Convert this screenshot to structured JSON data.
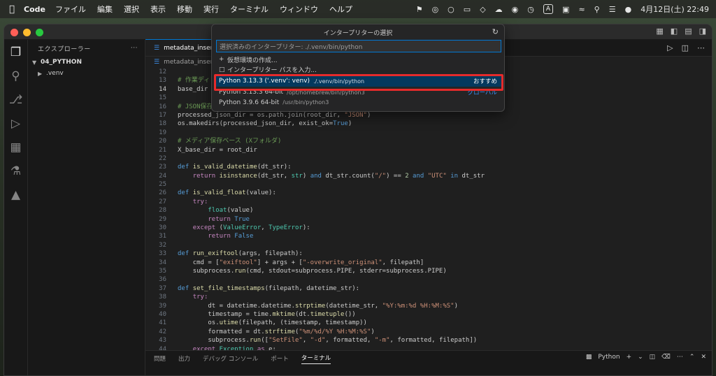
{
  "menubar": {
    "apple": "",
    "app": "Code",
    "items": [
      "ファイル",
      "編集",
      "選択",
      "表示",
      "移動",
      "実行",
      "ターミナル",
      "ウィンドウ",
      "ヘルプ"
    ],
    "ime": "A",
    "clock": "4月12日(土)  22:49"
  },
  "sidebar": {
    "header": "エクスプローラー",
    "more": "···",
    "folder": "04_PYTHON",
    "subfolder": ".venv"
  },
  "editor": {
    "tab_label": "metadata_insert.py",
    "breadcrumb": "metadata_insert.py"
  },
  "quickpick": {
    "title": "インタープリターの選択",
    "input_value": "選択済みのインタープリター: ./.venv/bin/python",
    "create_env": "仮想環境の作成...",
    "enter_path": "インタープリター パスを入力...",
    "options": [
      {
        "name": "Python 3.13.3 ('.venv': venv)",
        "path": "./.venv/bin/python",
        "tag": "おすすめ"
      },
      {
        "name": "Python 3.13.3 64-bit",
        "path": "/opt/homebrew/bin/python3",
        "tag": "グローバル"
      },
      {
        "name": "Python 3.9.6 64-bit",
        "path": "/usr/bin/python3",
        "tag": ""
      }
    ]
  },
  "code": {
    "line_numbers": [
      "12",
      "13",
      "14",
      "15",
      "16",
      "17",
      "18",
      "19",
      "20",
      "21",
      "22",
      "23",
      "24",
      "25",
      "26",
      "27",
      "28",
      "29",
      "30",
      "31",
      "32",
      "33",
      "34",
      "35",
      "36",
      "37",
      "38",
      "39",
      "40",
      "41",
      "42",
      "43",
      "44"
    ],
    "l12": "",
    "l13": "# 作業ディレ",
    "l14a": "base_dir = ",
    "l16": "# JSON保存先",
    "l17a": "processed_json_dir = os.path.join(root_dir, ",
    "l17s": "\"JSON\"",
    "l17b": ")",
    "l18a": "os.makedirs(processed_json_dir, exist_ok=",
    "l18k": "True",
    "l18b": ")",
    "l20": "# メディア保存ベース (Xフォルダ)",
    "l21": "X_base_dir = root_dir",
    "l23k": "def ",
    "l23f": "is_valid_datetime",
    "l23b": "(dt_str):",
    "l24k": "return ",
    "l24f": "isinstance",
    "l24a": "(dt_str, ",
    "l24t": "str",
    "l24b": ") ",
    "l24and": "and",
    "l24c": " dt_str.count(",
    "l24s1": "\"/\"",
    "l24d": ") == ",
    "l24n": "2",
    "l24e": " ",
    "l24and2": "and",
    "l24f2": " ",
    "l24s2": "\"UTC\"",
    "l24g": " ",
    "l24in": "in",
    "l24h": " dt_str",
    "l26k": "def ",
    "l26f": "is_valid_float",
    "l26b": "(value):",
    "l27": "try:",
    "l28f": "float",
    "l28b": "(value)",
    "l29k": "return ",
    "l29v": "True",
    "l30k": "except ",
    "l30a": "(",
    "l30t1": "ValueError",
    "l30b": ", ",
    "l30t2": "TypeError",
    "l30c": "):",
    "l31k": "return ",
    "l31v": "False",
    "l33k": "def ",
    "l33f": "run_exiftool",
    "l33b": "(args, filepath):",
    "l34a": "cmd = [",
    "l34s1": "\"exiftool\"",
    "l34b": "] + args + [",
    "l34s2": "\"-overwrite_original\"",
    "l34c": ", filepath]",
    "l35a": "subprocess.",
    "l35f": "run",
    "l35b": "(cmd, stdout=subprocess.PIPE, stderr=subprocess.PIPE)",
    "l37k": "def ",
    "l37f": "set_file_timestamps",
    "l37b": "(filepath, datetime_str):",
    "l38": "try:",
    "l39a": "dt = datetime.datetime.",
    "l39f": "strptime",
    "l39b": "(datetime_str, ",
    "l39s": "\"%Y:%m:%d %H:%M:%S\"",
    "l39c": ")",
    "l40a": "timestamp = time.",
    "l40f": "mktime",
    "l40b": "(dt.",
    "l40f2": "timetuple",
    "l40c": "())",
    "l41a": "os.",
    "l41f": "utime",
    "l41b": "(filepath, (timestamp, timestamp))",
    "l42a": "formatted = dt.",
    "l42f": "strftime",
    "l42b": "(",
    "l42s": "\"%m/%d/%Y %H:%M:%S\"",
    "l42c": ")",
    "l43a": "subprocess.",
    "l43f": "run",
    "l43b": "([",
    "l43s1": "\"SetFile\"",
    "l43c": ", ",
    "l43s2": "\"-d\"",
    "l43d": ", formatted, ",
    "l43s3": "\"-m\"",
    "l43e": ", formatted, filepath])",
    "l44k": "except ",
    "l44t": "Exception",
    "l44a": " ",
    "l44as": "as",
    "l44b": " e:"
  },
  "panel": {
    "tabs": [
      "問題",
      "出力",
      "デバッグ コンソール",
      "ポート",
      "ターミナル"
    ],
    "terminal_name": "Python"
  },
  "colors": {
    "accent": "#0078d4",
    "selection": "#04395e",
    "highlight": "#e52b2b"
  }
}
